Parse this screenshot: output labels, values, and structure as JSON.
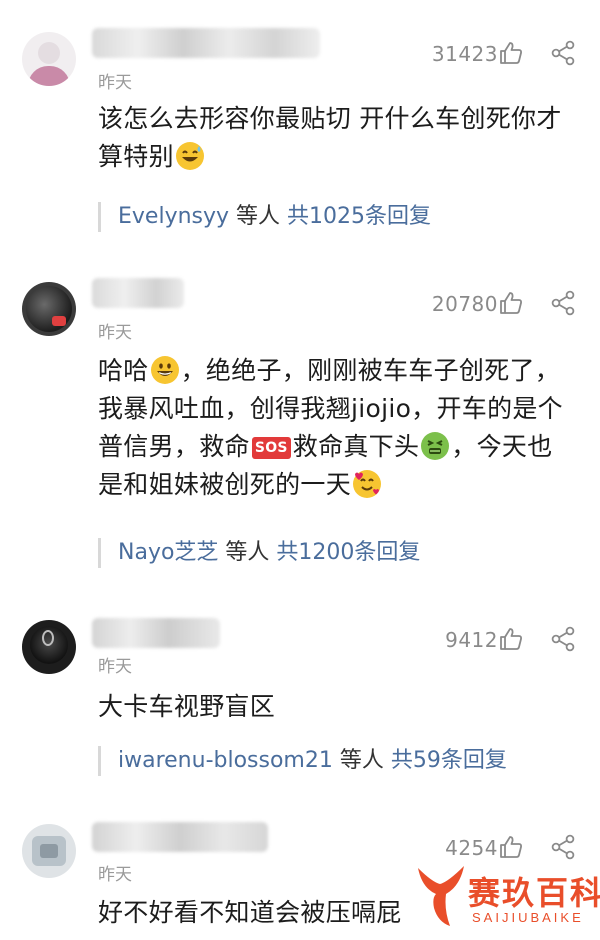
{
  "comments": [
    {
      "time": "昨天",
      "likes": "31423",
      "text_parts": [
        "该怎么去形容你最贴切 开什么车创死你才算特别"
      ],
      "reply_name": "Evelynsyy",
      "reply_mid": " 等人 ",
      "reply_count": "共1025条回复"
    },
    {
      "time": "昨天",
      "likes": "20780",
      "text_parts": [
        "哈哈",
        "，绝绝子，刚刚被车车子创死了，我暴风吐血，创得我翘jiojio，开车的是个普信男，救命",
        "救命真下头",
        "，今天也是和姐妹被创死的一天"
      ],
      "sos_label": "SOS",
      "reply_name": "Nayo芝芝",
      "reply_mid": " 等人 ",
      "reply_count": "共1200条回复"
    },
    {
      "time": "昨天",
      "likes": "9412",
      "text_parts": [
        "大卡车视野盲区"
      ],
      "reply_name": "iwarenu-blossom21",
      "reply_mid": " 等人 ",
      "reply_count": "共59条回复"
    },
    {
      "time": "昨天",
      "likes": "4254",
      "text_parts": [
        "好不好看不知道会被压嗝屁"
      ]
    }
  ],
  "watermark": {
    "title": "赛玖百科",
    "subtitle": "SAIJIUBAIKE"
  },
  "colors": {
    "link": "#4a6d9c",
    "muted": "#9a9a9a",
    "watermark": "#e94e2a"
  },
  "icons": {
    "like": "thumbs-up-icon",
    "share": "share-icon"
  }
}
